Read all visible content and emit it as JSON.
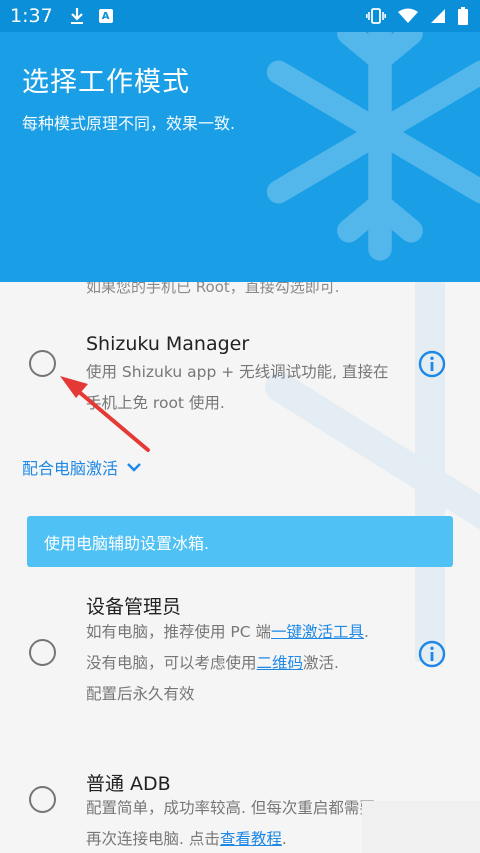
{
  "status_bar": {
    "time": "1:37",
    "icons": [
      "download-icon",
      "a-badge-icon",
      "vibrate-icon",
      "wifi-icon",
      "signal-icon",
      "battery-icon"
    ],
    "a_badge": "A"
  },
  "header": {
    "title": "选择工作模式",
    "subtitle": "每种模式原理不同，效果一致."
  },
  "content": {
    "cut_text": "如果您的手机已 Root，直接勾选即可.",
    "shizuku": {
      "title": "Shizuku Manager",
      "desc": "使用 Shizuku app + 无线调试功能, 直接在手机上免 root 使用."
    },
    "pc_section": {
      "label": "配合电脑激活"
    },
    "banner": "使用电脑辅助设置冰箱.",
    "device_admin": {
      "title": "设备管理员",
      "desc1_pre": "如有电脑，推荐使用 PC 端",
      "desc1_link": "一键激活工具",
      "desc1_post": ".",
      "desc2_pre": "没有电脑，可以考虑使用",
      "desc2_link": "二维码",
      "desc2_post": "激活.",
      "desc3": "配置后永久有效"
    },
    "adb": {
      "title": "普通 ADB",
      "desc_pre": "配置简单，成功率较高. 但每次重启都需要再次连接电脑. 点击",
      "desc_link": "查看教程",
      "desc_post": "."
    }
  },
  "colors": {
    "status_bar": "#0a8fd8",
    "header": "#1a9fe6",
    "banner": "#4fc1f4",
    "link": "#1e88e5",
    "arrow": "#e53935"
  }
}
